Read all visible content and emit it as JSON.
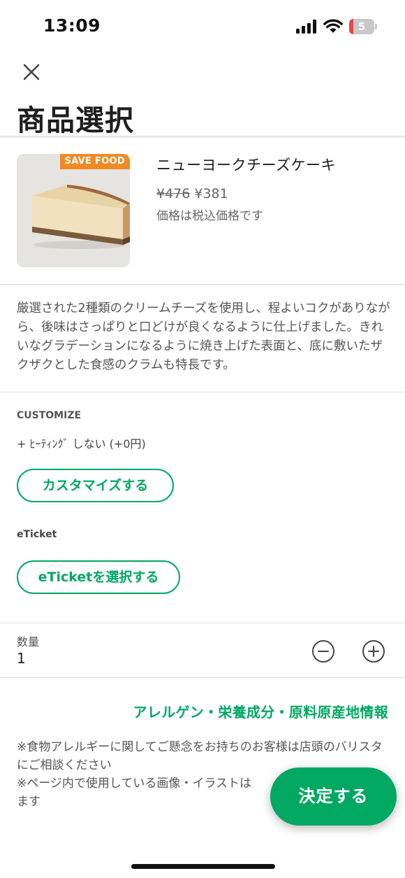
{
  "status_bar": {
    "time": "13:09",
    "battery_level": "5",
    "icons": [
      "cellular-signal-icon",
      "wifi-icon",
      "battery-icon"
    ]
  },
  "header": {
    "close_icon": "close-icon",
    "title": "商品選択"
  },
  "product": {
    "badge": "SAVE FOOD",
    "name": "ニューヨークチーズケーキ",
    "price_original": "¥476",
    "price_current": "¥381",
    "price_note": "価格は税込価格です",
    "description": "厳選された2種類のクリームチーズを使用し、程よいコクがありながら、後味はさっぱりと口どけが良くなるように仕上げました。きれいなグラデーションになるように焼き上げた表面と、底に敷いたザクザクとした食感のクラムも特長です。"
  },
  "customize": {
    "heading": "CUSTOMIZE",
    "option": "+ ﾋｰﾃｨﾝｸﾞ しない (+0円)",
    "button_label": "カスタマイズする"
  },
  "eticket": {
    "heading": "eTicket",
    "button_label": "eTicketを選択する"
  },
  "quantity": {
    "label": "数量",
    "value": "1",
    "minus_icon": "minus-circle-icon",
    "plus_icon": "plus-circle-icon"
  },
  "allergen_link": "アレルゲン・栄養成分・原料原産地情報",
  "notes": [
    "※食物アレルギーに関してご懸念をお持ちのお客様は店頭のバリスタにご相談ください",
    "※ページ内で使用している画像・イラストは",
    "ます"
  ],
  "confirm_button": "決定する",
  "colors": {
    "accent_green": "#00a862",
    "badge_orange": "#f08a24",
    "battery_low_red": "#e5484d"
  }
}
